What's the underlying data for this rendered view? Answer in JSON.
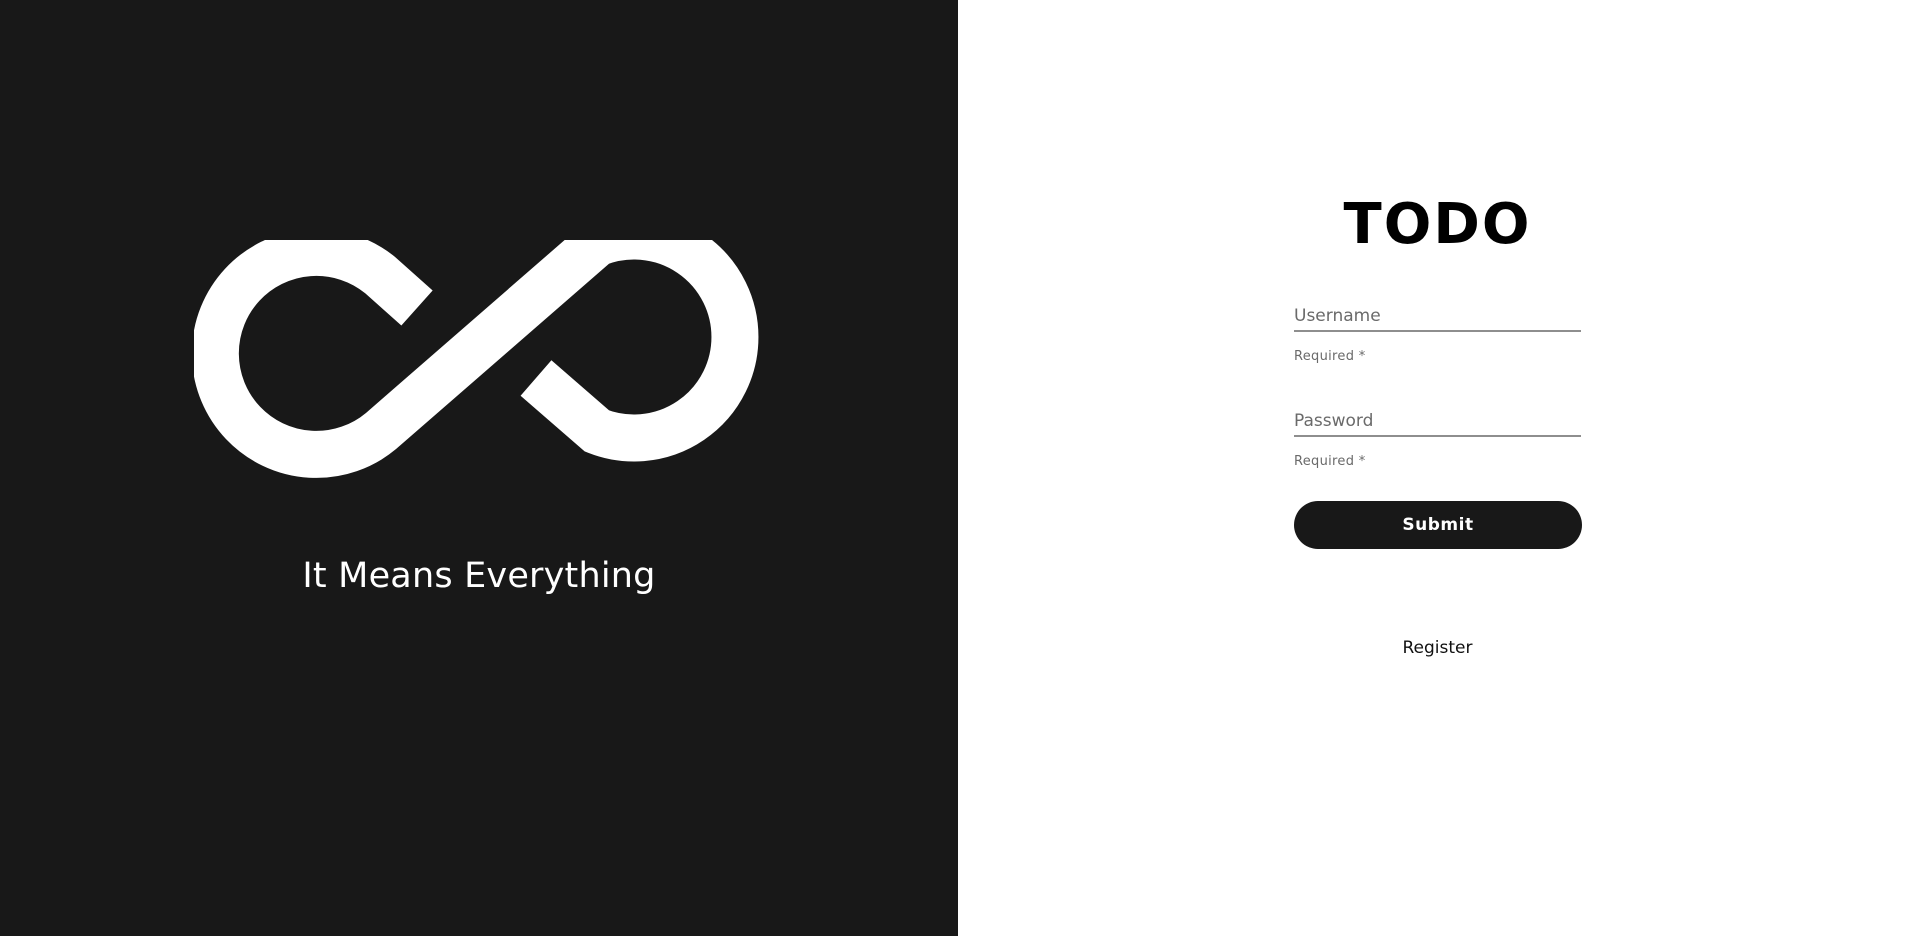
{
  "left_panel": {
    "logo_icon": "infinity-icon",
    "tagline": "It Means Everything"
  },
  "right_panel": {
    "title": "TODO",
    "username": {
      "placeholder": "Username",
      "value": "",
      "helper": "Required *"
    },
    "password": {
      "placeholder": "Password",
      "value": "",
      "helper": "Required *"
    },
    "submit_label": "Submit",
    "register_label": "Register"
  },
  "colors": {
    "dark_panel": "#181818",
    "light_panel": "#ffffff",
    "accent": "#181818",
    "helper_text": "#6a6a6a"
  }
}
